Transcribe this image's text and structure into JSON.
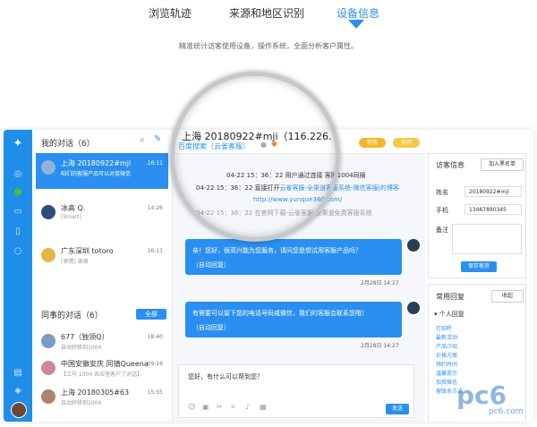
{
  "top_tabs": [
    {
      "label": "浏览轨迹"
    },
    {
      "label": "来源和地区识别"
    },
    {
      "label": "设备信息"
    }
  ],
  "subtitle": "精准统计访客使用设备，操作系统，全面分析客户属性。",
  "conversations": {
    "my_title": "我的对话（6）",
    "my_items": [
      {
        "name": "上海 20180922#mji",
        "msg": "咱们的客服产品可以对接微信",
        "time": "16:11"
      },
      {
        "name": "冰高 Q.",
        "msg": "[Smart]",
        "time": "14:26"
      },
      {
        "name": "广东深圳 totoro",
        "msg": "[表情] 谢谢",
        "time": "16:11"
      }
    ],
    "colleague_title": "同事的对话（6）",
    "all_button": "全部",
    "colleague_items": [
      {
        "name": "677（独领Q）",
        "msg": "自动转移到1004",
        "time": "18:40"
      },
      {
        "name": "中国安徽安庆 同镇Queena",
        "msg": "【工号 1004 去应答客户了对话】",
        "time": "09:16"
      },
      {
        "name": "上海 20180305#63",
        "msg": "自动转移到1004",
        "time": "15:55"
      }
    ]
  },
  "chat": {
    "header_title": "上海 20180922#mji（116.226.",
    "header_source": "百度搜索（云雀客服）",
    "transfer_button": "转接",
    "close_button": "关闭",
    "sys_line1": "04-22 15：36：22 用户通过连接 客服1004同摘",
    "sys_line2_prefix": "04-22 15：36：22 直接打开",
    "sys_line2_link": "云雀客服-全渠道客服系统-微信客服|的博客",
    "sys_line3_link": "http://www.yunque360.com/",
    "sys_line4": "04-22 15：36：22 在官网下载-云雀客服-全渠道免费客服系统",
    "bubble1_line1": "亲！您好，很高兴能为您服务，请问您是想试用客服产品吗？",
    "bubble1_line2": "（自动回复）",
    "bubble1_time": "2月28日 14:27",
    "bubble2_line1": "有需要可以留下您的电话号码或微信，我们的客服会联系您哦！",
    "bubble2_line2": "（自动回复）",
    "bubble2_time": "2月28日 14:27",
    "input_text": "您好，有什么可以帮到您？",
    "send_button": "发送"
  },
  "visitor": {
    "title": "访客信息",
    "blacklist_button": "加入黑名单",
    "name_label": "姓名",
    "name_value": "20180922#mji",
    "phone_label": "手机",
    "phone_value": "13467890345",
    "remark_label": "备注",
    "save_button": "保存客资",
    "quick_title": "常用回复",
    "collapse_button": "收起",
    "personal_title": "个人回复",
    "quick_items": [
      "打招呼",
      "最新活动",
      "产品介绍",
      "价格方案",
      "预约时间",
      "温馨提示",
      "加我微信",
      "留联系方式"
    ]
  },
  "watermark": {
    "logo": "pc6",
    "url": "pc6.com"
  },
  "colors": {
    "accent": "#2a8ff0",
    "sidebar": "#1f8ee8",
    "transfer": "#f5b728",
    "close": "#f5c84a"
  }
}
